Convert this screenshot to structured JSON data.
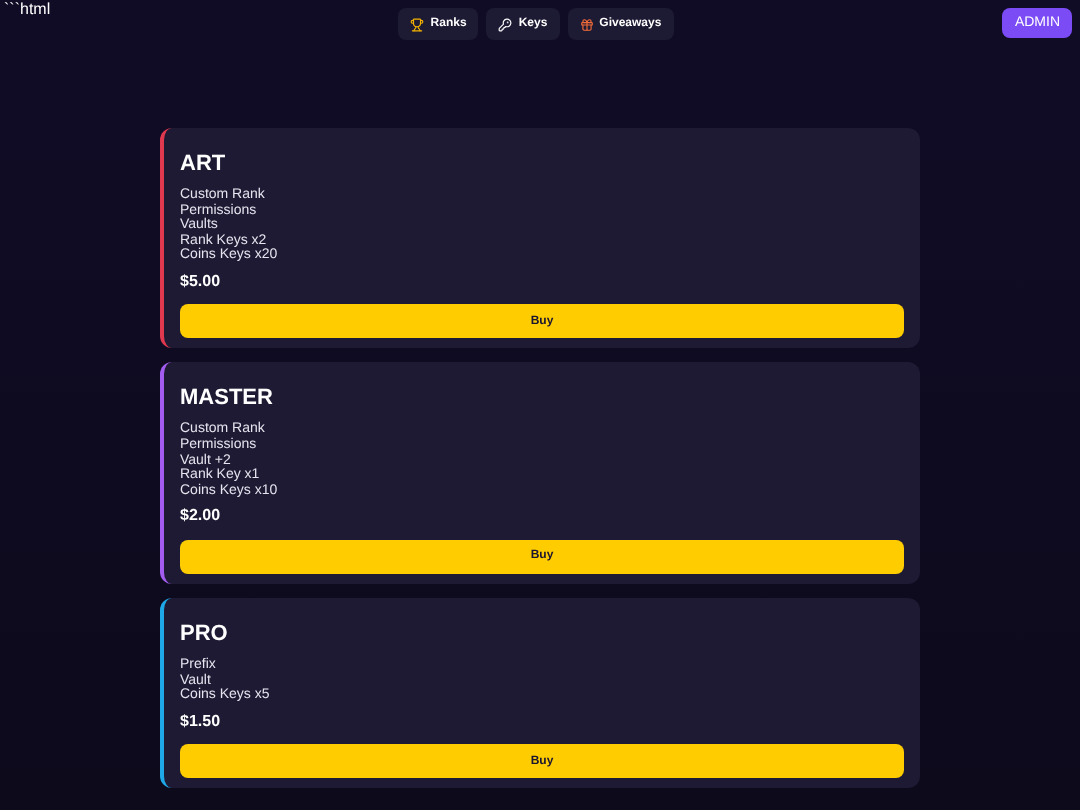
{
  "code_label": "```html",
  "nav": [
    {
      "kind": "trophy",
      "label": "Ranks"
    },
    {
      "kind": "key",
      "label": "Keys"
    },
    {
      "kind": "gift",
      "label": "Giveaways"
    }
  ],
  "admin_button": "ADMIN",
  "ranks": [
    {
      "name": "ART",
      "color": "#e0384f",
      "features": [
        "Custom Rank",
        "Permissions",
        "Vaults",
        "Rank Keys x2",
        "Coins Keys x20"
      ],
      "price": "$5.00",
      "button": "Buy"
    },
    {
      "name": "MASTER",
      "color": "#a25cf0",
      "features": [
        "Custom Rank",
        "Permissions",
        "Vault +2",
        "Rank Key x1",
        "Coins Keys x10"
      ],
      "price": "$2.00",
      "button": "Buy"
    },
    {
      "name": "PRO",
      "color": "#1fa8e8",
      "features": [
        "Prefix",
        "Vault",
        "Coins Keys x5"
      ],
      "price": "$1.50",
      "button": "Buy"
    }
  ]
}
